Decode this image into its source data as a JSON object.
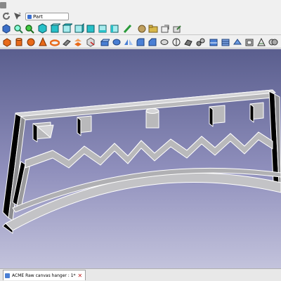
{
  "toolbar": {
    "workbench": "Part",
    "icons_row1": [
      "refresh-icon",
      "what-is-this-icon"
    ],
    "icons_row2": [
      "cube-icon",
      "zoom-icon",
      "view-isometric-icon",
      "view-front-icon",
      "view-top-icon",
      "view-right-icon",
      "view-rear-icon",
      "view-bottom-icon",
      "view-left-icon",
      "measure-icon",
      "part-icon",
      "group-icon",
      "link-icon",
      "link-sub-icon"
    ],
    "icons_row3": [
      "box-icon",
      "cylinder-icon",
      "sphere-icon",
      "cone-icon",
      "torus-icon",
      "tube-icon",
      "primitives-icon",
      "shape-builder-icon",
      "extrude-icon",
      "revolve-icon",
      "mirror-icon",
      "fillet-icon",
      "chamfer-icon",
      "make-face-icon",
      "ruled-surface-icon",
      "loft-icon",
      "sweep-icon",
      "section-icon",
      "cross-sections-icon",
      "offset-icon",
      "thickness-icon",
      "projection-icon",
      "boolean-icon",
      "cut-icon",
      "fuse-icon",
      "common-icon"
    ]
  },
  "document_tab": {
    "label": "ACME Raw canvas hanger : 1*"
  },
  "colors": {
    "viewport_top": "#5a5e8e",
    "viewport_bottom": "#c3c3dc",
    "model_face": "#b9b9bb",
    "model_edge": "#ffffff",
    "model_shadow": "#000000",
    "accent_cube": "#27c0c8"
  }
}
